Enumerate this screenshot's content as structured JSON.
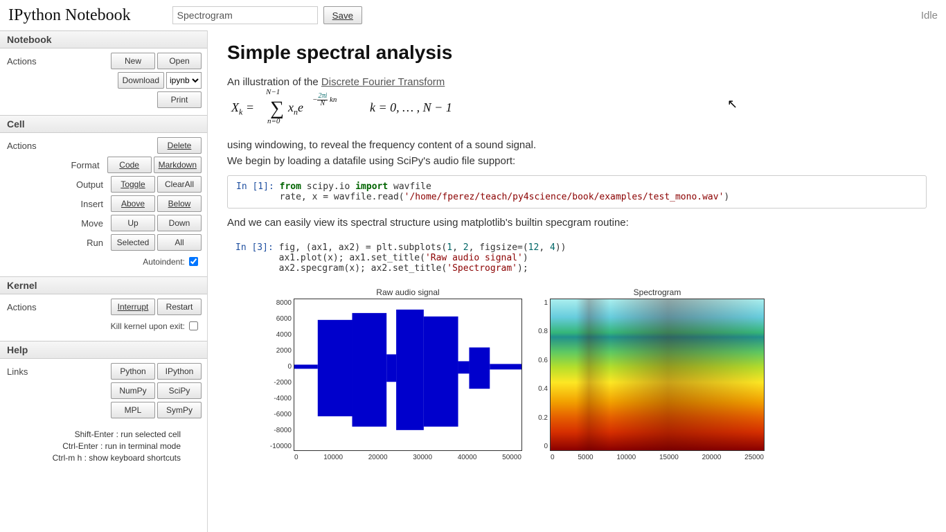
{
  "app_title": "IPython Notebook",
  "notebook_name": "Spectrogram",
  "save_label": "Save",
  "status": "Idle",
  "sidebar": {
    "notebook": {
      "header": "Notebook",
      "actions_label": "Actions",
      "new": "New",
      "open": "Open",
      "download": "Download",
      "download_format": "ipynb",
      "print": "Print"
    },
    "cell": {
      "header": "Cell",
      "actions_label": "Actions",
      "delete": "Delete",
      "format_label": "Format",
      "code": "Code",
      "markdown": "Markdown",
      "output_label": "Output",
      "toggle": "Toggle",
      "clearall": "ClearAll",
      "insert_label": "Insert",
      "above": "Above",
      "below": "Below",
      "move_label": "Move",
      "up": "Up",
      "down": "Down",
      "run_label": "Run",
      "selected": "Selected",
      "all": "All",
      "autoindent_label": "Autoindent:",
      "autoindent_checked": true
    },
    "kernel": {
      "header": "Kernel",
      "actions_label": "Actions",
      "interrupt": "Interrupt",
      "restart": "Restart",
      "kill_label": "Kill kernel upon exit:",
      "kill_checked": false
    },
    "help": {
      "header": "Help",
      "links_label": "Links",
      "python": "Python",
      "ipython": "IPython",
      "numpy": "NumPy",
      "scipy": "SciPy",
      "mpl": "MPL",
      "sympy": "SymPy",
      "hints": [
        "Shift-Enter : run selected cell",
        "Ctrl-Enter : run in terminal mode",
        "Ctrl-m h : show keyboard shortcuts"
      ]
    }
  },
  "doc": {
    "title": "Simple spectral analysis",
    "intro1": "An illustration of the ",
    "link_text": "Discrete Fourier Transform",
    "formula": {
      "lhs": "X",
      "lhs_sub": "k",
      "eq": " = ",
      "sum_top": "N−1",
      "sum_bot": "n=0",
      "term": "x",
      "term_sub": "n",
      "e": "e",
      "sup_prefix": "−",
      "frac_num": "2πi",
      "frac_den": "N",
      "sup_suffix": " kn",
      "kpart": "k = 0, … , N − 1"
    },
    "para2a": "using windowing, to reveal the frequency content of a sound signal.",
    "para2b": "We begin by loading a datafile using SciPy's audio file support:",
    "para3": "And we can easily view its spectral structure using matplotlib's builtin specgram routine:",
    "cell1": {
      "prompt": "In [1]:",
      "line1_pre": "from",
      "line1_mod": " scipy.io ",
      "line1_imp": "import",
      "line1_rest": " wavfile",
      "line2_pre": "rate, x = wavfile.read(",
      "line2_str": "'/home/fperez/teach/py4science/book/examples/test_mono.wav'",
      "line2_end": ")"
    },
    "cell3": {
      "prompt": "In [3]:",
      "l1a": "fig, (ax1, ax2) = plt.subplots(",
      "l1n1": "1",
      "l1b": ", ",
      "l1n2": "2",
      "l1c": ", figsize=(",
      "l1n3": "12",
      "l1d": ", ",
      "l1n4": "4",
      "l1e": "))",
      "l2a": "ax1.plot(x); ax1.set_title(",
      "l2s": "'Raw audio signal'",
      "l2b": ")",
      "l3a": "ax2.specgram(x); ax2.set_title(",
      "l3s": "'Spectrogram'",
      "l3b": ");"
    }
  },
  "chart_data": [
    {
      "type": "line",
      "title": "Raw audio signal",
      "xlabel": "",
      "ylabel": "",
      "xlim": [
        0,
        50000
      ],
      "ylim": [
        -10000,
        8000
      ],
      "xticks": [
        0,
        10000,
        20000,
        30000,
        40000,
        50000
      ],
      "yticks": [
        -10000,
        -8000,
        -6000,
        -4000,
        -2000,
        0,
        2000,
        4000,
        6000,
        8000
      ],
      "description": "dense blue audio waveform; near-zero for x<~5000; large amplitude (~±7000) from ~5000–36000 with brief quiet gap near 22000; small trailing segment ~38000–44000; mostly quiet after"
    },
    {
      "type": "heatmap",
      "title": "Spectrogram",
      "xlabel": "",
      "ylabel": "",
      "xlim": [
        0,
        25000
      ],
      "ylim": [
        0.0,
        1.0
      ],
      "xticks": [
        0,
        5000,
        10000,
        15000,
        20000,
        25000
      ],
      "yticks": [
        0.0,
        0.2,
        0.4,
        0.6,
        0.8,
        1.0
      ],
      "colormap": "jet-like (blue→green→yellow→red)",
      "description": "energy concentrated at low frequencies (bottom, red/orange bands with harmonic striations); lower energy (green/cyan) at high frequencies; vertical intensity changes tracking waveform onsets"
    }
  ]
}
